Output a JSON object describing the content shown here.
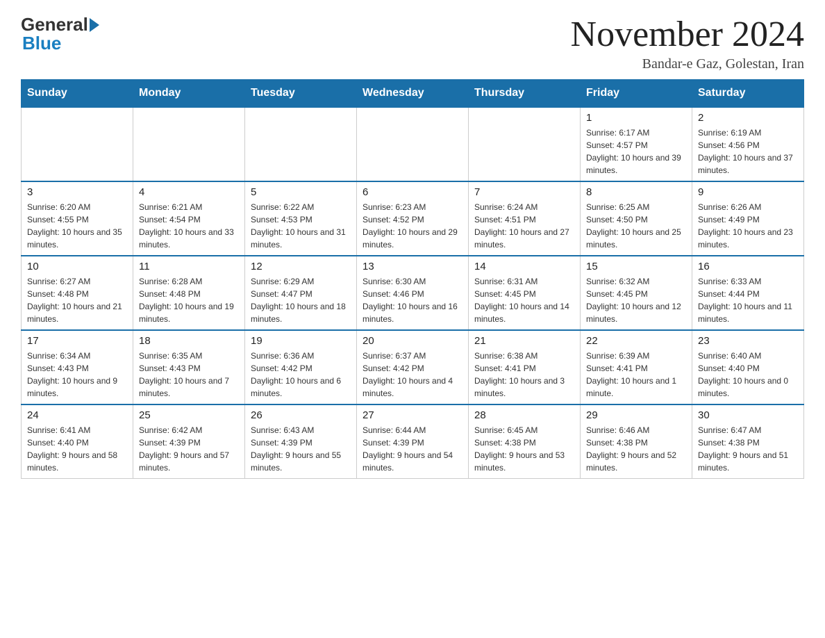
{
  "header": {
    "logo_general": "General",
    "logo_blue": "Blue",
    "title": "November 2024",
    "subtitle": "Bandar-e Gaz, Golestan, Iran"
  },
  "days_of_week": [
    "Sunday",
    "Monday",
    "Tuesday",
    "Wednesday",
    "Thursday",
    "Friday",
    "Saturday"
  ],
  "weeks": [
    [
      {
        "day": "",
        "info": ""
      },
      {
        "day": "",
        "info": ""
      },
      {
        "day": "",
        "info": ""
      },
      {
        "day": "",
        "info": ""
      },
      {
        "day": "",
        "info": ""
      },
      {
        "day": "1",
        "info": "Sunrise: 6:17 AM\nSunset: 4:57 PM\nDaylight: 10 hours and 39 minutes."
      },
      {
        "day": "2",
        "info": "Sunrise: 6:19 AM\nSunset: 4:56 PM\nDaylight: 10 hours and 37 minutes."
      }
    ],
    [
      {
        "day": "3",
        "info": "Sunrise: 6:20 AM\nSunset: 4:55 PM\nDaylight: 10 hours and 35 minutes."
      },
      {
        "day": "4",
        "info": "Sunrise: 6:21 AM\nSunset: 4:54 PM\nDaylight: 10 hours and 33 minutes."
      },
      {
        "day": "5",
        "info": "Sunrise: 6:22 AM\nSunset: 4:53 PM\nDaylight: 10 hours and 31 minutes."
      },
      {
        "day": "6",
        "info": "Sunrise: 6:23 AM\nSunset: 4:52 PM\nDaylight: 10 hours and 29 minutes."
      },
      {
        "day": "7",
        "info": "Sunrise: 6:24 AM\nSunset: 4:51 PM\nDaylight: 10 hours and 27 minutes."
      },
      {
        "day": "8",
        "info": "Sunrise: 6:25 AM\nSunset: 4:50 PM\nDaylight: 10 hours and 25 minutes."
      },
      {
        "day": "9",
        "info": "Sunrise: 6:26 AM\nSunset: 4:49 PM\nDaylight: 10 hours and 23 minutes."
      }
    ],
    [
      {
        "day": "10",
        "info": "Sunrise: 6:27 AM\nSunset: 4:48 PM\nDaylight: 10 hours and 21 minutes."
      },
      {
        "day": "11",
        "info": "Sunrise: 6:28 AM\nSunset: 4:48 PM\nDaylight: 10 hours and 19 minutes."
      },
      {
        "day": "12",
        "info": "Sunrise: 6:29 AM\nSunset: 4:47 PM\nDaylight: 10 hours and 18 minutes."
      },
      {
        "day": "13",
        "info": "Sunrise: 6:30 AM\nSunset: 4:46 PM\nDaylight: 10 hours and 16 minutes."
      },
      {
        "day": "14",
        "info": "Sunrise: 6:31 AM\nSunset: 4:45 PM\nDaylight: 10 hours and 14 minutes."
      },
      {
        "day": "15",
        "info": "Sunrise: 6:32 AM\nSunset: 4:45 PM\nDaylight: 10 hours and 12 minutes."
      },
      {
        "day": "16",
        "info": "Sunrise: 6:33 AM\nSunset: 4:44 PM\nDaylight: 10 hours and 11 minutes."
      }
    ],
    [
      {
        "day": "17",
        "info": "Sunrise: 6:34 AM\nSunset: 4:43 PM\nDaylight: 10 hours and 9 minutes."
      },
      {
        "day": "18",
        "info": "Sunrise: 6:35 AM\nSunset: 4:43 PM\nDaylight: 10 hours and 7 minutes."
      },
      {
        "day": "19",
        "info": "Sunrise: 6:36 AM\nSunset: 4:42 PM\nDaylight: 10 hours and 6 minutes."
      },
      {
        "day": "20",
        "info": "Sunrise: 6:37 AM\nSunset: 4:42 PM\nDaylight: 10 hours and 4 minutes."
      },
      {
        "day": "21",
        "info": "Sunrise: 6:38 AM\nSunset: 4:41 PM\nDaylight: 10 hours and 3 minutes."
      },
      {
        "day": "22",
        "info": "Sunrise: 6:39 AM\nSunset: 4:41 PM\nDaylight: 10 hours and 1 minute."
      },
      {
        "day": "23",
        "info": "Sunrise: 6:40 AM\nSunset: 4:40 PM\nDaylight: 10 hours and 0 minutes."
      }
    ],
    [
      {
        "day": "24",
        "info": "Sunrise: 6:41 AM\nSunset: 4:40 PM\nDaylight: 9 hours and 58 minutes."
      },
      {
        "day": "25",
        "info": "Sunrise: 6:42 AM\nSunset: 4:39 PM\nDaylight: 9 hours and 57 minutes."
      },
      {
        "day": "26",
        "info": "Sunrise: 6:43 AM\nSunset: 4:39 PM\nDaylight: 9 hours and 55 minutes."
      },
      {
        "day": "27",
        "info": "Sunrise: 6:44 AM\nSunset: 4:39 PM\nDaylight: 9 hours and 54 minutes."
      },
      {
        "day": "28",
        "info": "Sunrise: 6:45 AM\nSunset: 4:38 PM\nDaylight: 9 hours and 53 minutes."
      },
      {
        "day": "29",
        "info": "Sunrise: 6:46 AM\nSunset: 4:38 PM\nDaylight: 9 hours and 52 minutes."
      },
      {
        "day": "30",
        "info": "Sunrise: 6:47 AM\nSunset: 4:38 PM\nDaylight: 9 hours and 51 minutes."
      }
    ]
  ]
}
